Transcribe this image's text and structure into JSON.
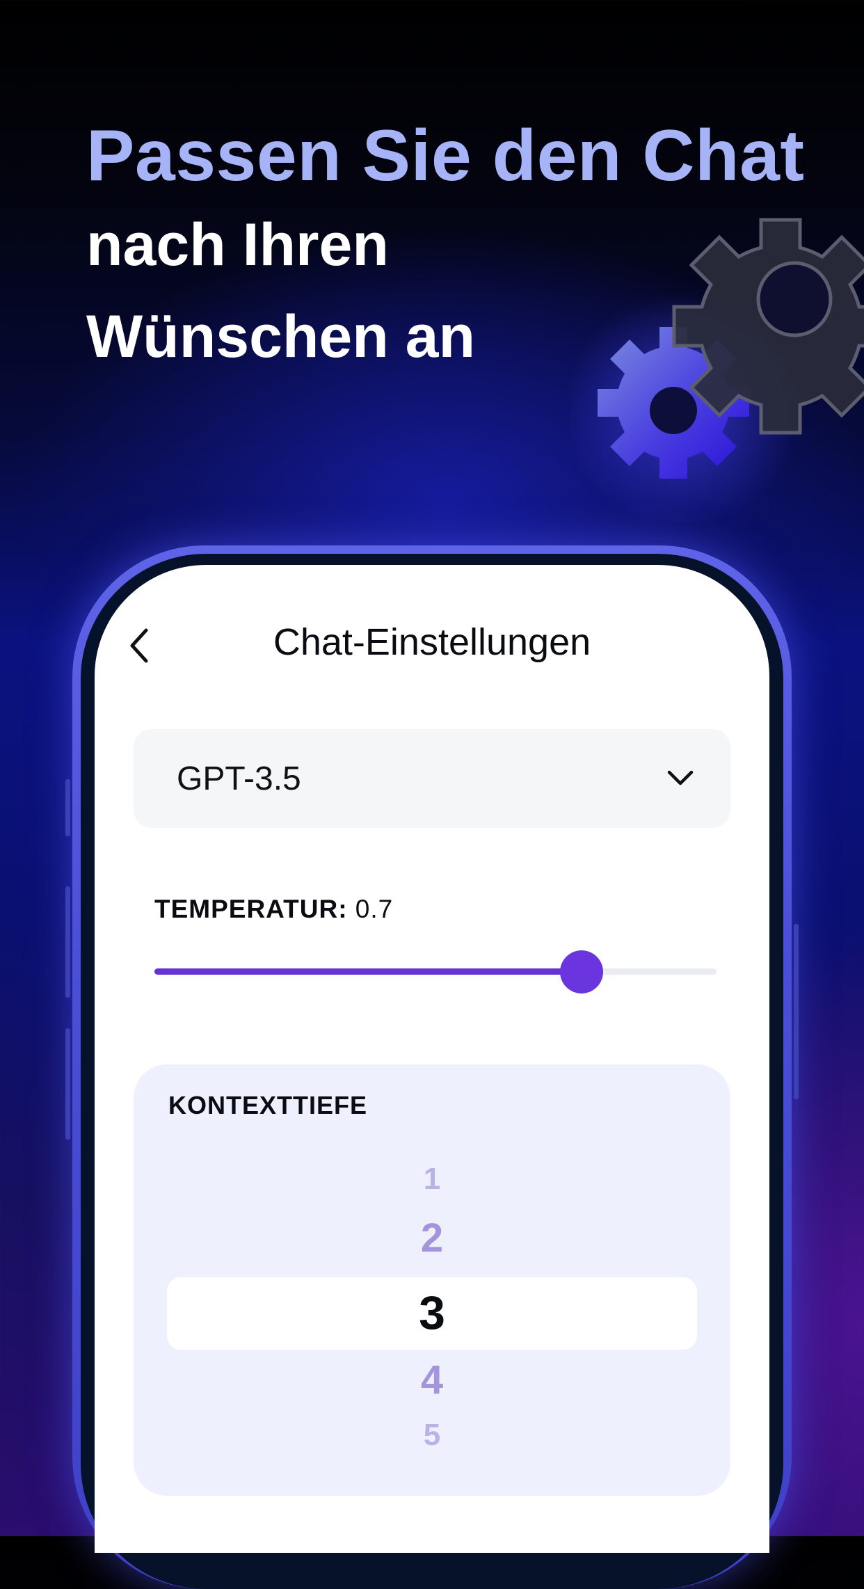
{
  "headline": {
    "line1": "Passen Sie den Chat",
    "line2": "nach Ihren",
    "line3": "Wünschen an"
  },
  "decoration": {
    "icon": "gear-icon",
    "accent_color": "#a6b4f7"
  },
  "screen": {
    "title": "Chat-Einstellungen",
    "back_icon": "chevron-left-icon",
    "model": {
      "value": "GPT-3.5",
      "icon": "chevron-down-icon"
    },
    "temperature": {
      "label": "TEMPERATUR:",
      "value": "0.7",
      "slider_level": 0.76,
      "color": "#6533d4"
    },
    "context_depth": {
      "label": "KONTEXTTIEFE",
      "options": [
        "1",
        "2",
        "3",
        "4",
        "5"
      ],
      "selected": "3"
    }
  }
}
